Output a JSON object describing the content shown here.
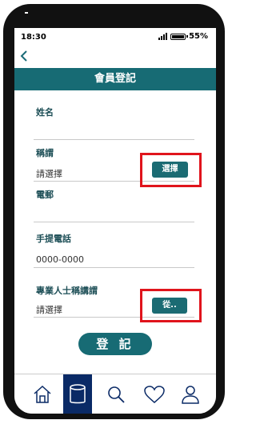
{
  "status_bar": {
    "time": "18:30",
    "battery": "55%"
  },
  "header": {
    "title": "會員登記"
  },
  "form": {
    "name_label": "姓名",
    "title_label": "稱謂",
    "title_value": "請選擇",
    "title_button": "選擇",
    "email_label": "電郵",
    "mobile_label": "手提電話",
    "mobile_placeholder": "0000-0000",
    "professional_title_label": "專業人士稱講謂",
    "professional_title_value": "請選擇",
    "professional_title_button": "從.."
  },
  "submit_label": "登 記",
  "bottom_nav": [
    {
      "icon": "home-icon"
    },
    {
      "icon": "database-icon",
      "active": true
    },
    {
      "icon": "search-icon"
    },
    {
      "icon": "heart-icon"
    },
    {
      "icon": "user-icon"
    }
  ],
  "colors": {
    "primary": "#176b74",
    "nav_active": "#0a2a66",
    "highlight": "#e0141c"
  }
}
